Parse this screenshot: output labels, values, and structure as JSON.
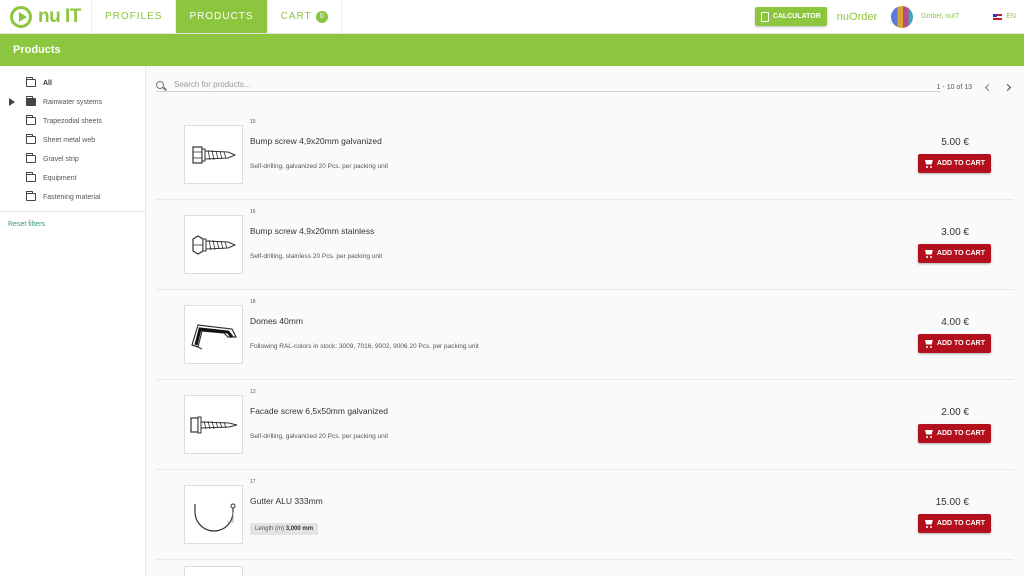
{
  "nav": {
    "logo_text": "nu IT",
    "items": [
      {
        "label": "PROFILES"
      },
      {
        "label": "PRODUCTS"
      },
      {
        "label": "CART"
      }
    ],
    "cart_count": "0",
    "calculator_label": "CALCULATOR",
    "brand": "nuOrder",
    "company": "GmbH, nuIT",
    "language": "EN"
  },
  "page": {
    "title": "Products"
  },
  "sidebar": {
    "categories": [
      {
        "label": "All"
      },
      {
        "label": "Rainwater systems"
      },
      {
        "label": "Trapezodial sheets"
      },
      {
        "label": "Sheet metal web"
      },
      {
        "label": "Gravel strip"
      },
      {
        "label": "Equipment"
      },
      {
        "label": "Fastening material"
      }
    ],
    "reset_label": "Reset filters"
  },
  "search": {
    "placeholder": "Search for products..."
  },
  "pagination": {
    "label": "1 - 10 of 13"
  },
  "products": [
    {
      "number": "15",
      "name": "Bump screw 4,9x20mm galvanized",
      "description": "Self-drilling, galvanized 20 Pcs. per packing unit",
      "price": "5.00 €",
      "button": "ADD TO CART",
      "image_icon": "screw-icon"
    },
    {
      "number": "16",
      "name": "Bump screw 4,9x20mm stainless",
      "description": "Self-drilling, stainless 20 Pcs. per packing unit",
      "price": "3.00 €",
      "button": "ADD TO CART",
      "image_icon": "screw-icon"
    },
    {
      "number": "18",
      "name": "Domes 40mm",
      "description": "Following RAL-colors in stock: 3009, 7016, 9002, 9006 20 Pcs. per packing unit",
      "price": "4.00 €",
      "button": "ADD TO CART",
      "image_icon": "dome-icon"
    },
    {
      "number": "13",
      "name": "Facade screw 6,5x50mm galvanized",
      "description": "Self-drilling, galvanized 20 Pcs. per packing unit",
      "price": "2.00 €",
      "button": "ADD TO CART",
      "image_icon": "screw-icon"
    },
    {
      "number": "17",
      "name": "Gutter ALU 333mm",
      "chip_label": "Length (m)",
      "chip_value": "3,000 mm",
      "price": "15.00 €",
      "button": "ADD TO CART",
      "image_icon": "gutter-icon"
    }
  ],
  "colors": {
    "accent": "#8cc63f",
    "button": "#b3101d"
  }
}
